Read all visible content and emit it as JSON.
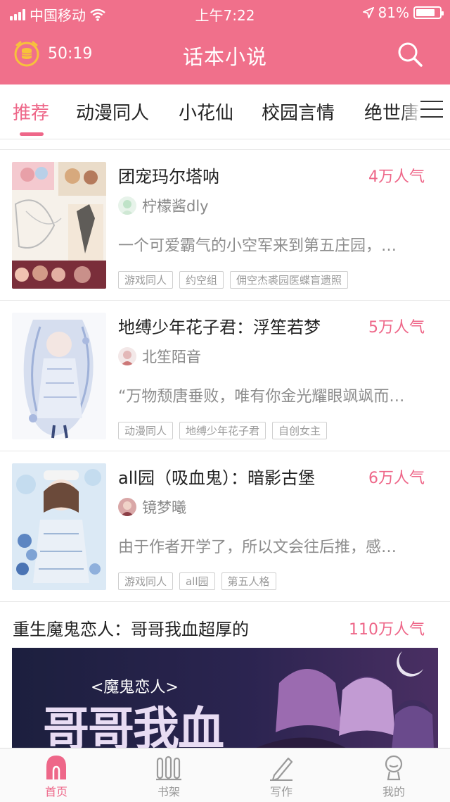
{
  "status": {
    "carrier": "中国移动",
    "time": "上午7:22",
    "battery": "81%",
    "battery_level": 0.81
  },
  "header": {
    "timer": "50:19",
    "title": "话本小说"
  },
  "tabs": [
    {
      "label": "推荐",
      "active": true
    },
    {
      "label": "动漫同人",
      "active": false
    },
    {
      "label": "小花仙",
      "active": false
    },
    {
      "label": "校园言情",
      "active": false
    },
    {
      "label": "绝世唐",
      "active": false
    }
  ],
  "books": [
    {
      "title": "团宠玛尔塔呐",
      "popularity": "4万人气",
      "author": "柠檬酱dly",
      "description": "一个可爱霸气的小空军来到第五庄园，…",
      "tags": [
        "游戏同人",
        "约空组",
        "佣空杰裘园医蝶盲遗照"
      ]
    },
    {
      "title": "地缚少年花子君：浮笙若梦",
      "popularity": "5万人气",
      "author": "北笙陌音",
      "description": "“万物颓唐垂败，唯有你金光耀眼飒飒而…",
      "tags": [
        "动漫同人",
        "地缚少年花子君",
        "自创女主"
      ]
    },
    {
      "title": "all园（吸血鬼）：暗影古堡",
      "popularity": "6万人气",
      "author": "镜梦曦",
      "description": "由于作者开学了，所以文会往后推，感…",
      "tags": [
        "游戏同人",
        "all园",
        "第五人格"
      ]
    }
  ],
  "featured": {
    "title": "重生魔鬼恋人：哥哥我血超厚的",
    "popularity": "110万人气",
    "banner_sub": "<魔鬼恋人>",
    "banner_main": "哥哥我血"
  },
  "bottom_nav": [
    {
      "label": "首页",
      "active": true
    },
    {
      "label": "书架",
      "active": false
    },
    {
      "label": "写作",
      "active": false
    },
    {
      "label": "我的",
      "active": false
    }
  ],
  "colors": {
    "accent": "#f0708b",
    "pink_text": "#ee6789"
  }
}
